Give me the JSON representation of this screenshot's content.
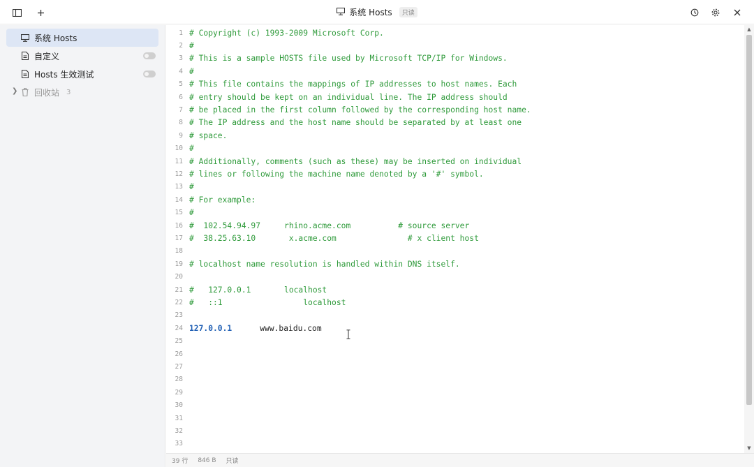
{
  "titlebar": {
    "title": "系统 Hosts",
    "readonly_badge": "只读",
    "left_icons": [
      "sidebar-toggle-icon",
      "plus-icon"
    ],
    "right_icons": [
      "history-icon",
      "gear-icon",
      "close-icon"
    ]
  },
  "sidebar": {
    "items": [
      {
        "label": "系统 Hosts",
        "icon": "monitor-icon",
        "active": true
      },
      {
        "label": "自定义",
        "icon": "file-icon",
        "toggle": false
      },
      {
        "label": "Hosts 生效测试",
        "icon": "file-icon",
        "toggle": false
      }
    ],
    "trash": {
      "label": "回收站",
      "count": "3",
      "icon": "trash-icon"
    }
  },
  "editor": {
    "lines": [
      {
        "n": "1",
        "text": "# Copyright (c) 1993-2009 Microsoft Corp."
      },
      {
        "n": "2",
        "text": "#"
      },
      {
        "n": "3",
        "text": "# This is a sample HOSTS file used by Microsoft TCP/IP for Windows."
      },
      {
        "n": "4",
        "text": "#"
      },
      {
        "n": "5",
        "text": "# This file contains the mappings of IP addresses to host names. Each"
      },
      {
        "n": "6",
        "text": "# entry should be kept on an individual line. The IP address should"
      },
      {
        "n": "7",
        "text": "# be placed in the first column followed by the corresponding host name."
      },
      {
        "n": "8",
        "text": "# The IP address and the host name should be separated by at least one"
      },
      {
        "n": "9",
        "text": "# space."
      },
      {
        "n": "10",
        "text": "#"
      },
      {
        "n": "11",
        "text": "# Additionally, comments (such as these) may be inserted on individual"
      },
      {
        "n": "12",
        "text": "# lines or following the machine name denoted by a '#' symbol."
      },
      {
        "n": "13",
        "text": "#"
      },
      {
        "n": "14",
        "text": "# For example:"
      },
      {
        "n": "15",
        "text": "#"
      },
      {
        "n": "16",
        "text": "#  102.54.94.97     rhino.acme.com          # source server"
      },
      {
        "n": "17",
        "text": "#  38.25.63.10       x.acme.com               # x client host"
      },
      {
        "n": "18",
        "text": ""
      },
      {
        "n": "19",
        "text": "# localhost name resolution is handled within DNS itself."
      },
      {
        "n": "20",
        "text": ""
      },
      {
        "n": "21",
        "text": "#   127.0.0.1       localhost"
      },
      {
        "n": "22",
        "text": "#   ::1                 localhost"
      },
      {
        "n": "23",
        "text": ""
      },
      {
        "n": "24",
        "ip": "127.0.0.1",
        "host": "www.baidu.com"
      },
      {
        "n": "25",
        "text": ""
      },
      {
        "n": "26",
        "text": ""
      },
      {
        "n": "27",
        "text": ""
      },
      {
        "n": "28",
        "text": ""
      },
      {
        "n": "29",
        "text": ""
      },
      {
        "n": "30",
        "text": ""
      },
      {
        "n": "31",
        "text": ""
      },
      {
        "n": "32",
        "text": ""
      },
      {
        "n": "33",
        "text": ""
      }
    ]
  },
  "statusbar": {
    "lines": "39 行",
    "size": "846 B",
    "mode": "只读"
  }
}
